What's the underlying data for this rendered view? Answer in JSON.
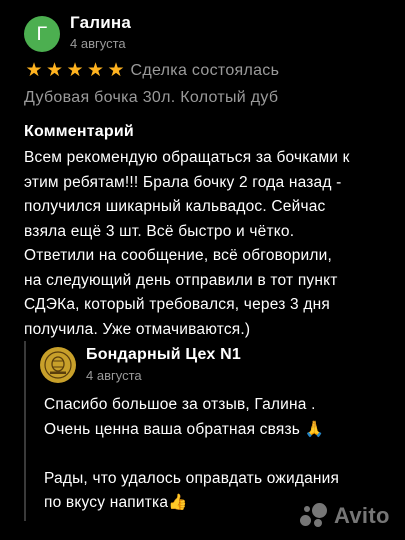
{
  "review": {
    "avatar_letter": "Г",
    "avatar_color": "#4caf50",
    "author_name": "Галина",
    "date": "4 августа",
    "rating": 5,
    "stars": [
      "★",
      "★",
      "★",
      "★",
      "★"
    ],
    "star_color": "#ffb320",
    "deal_status": "Сделка состоялась",
    "item_title": "Дубовая бочка 30л. Колотый дуб",
    "comment_heading": "Комментарий",
    "comment_text": "Всем рекомендую обращаться за бочками к\nэтим ребятам!!! Брала бочку 2 года назад -\nполучился шикарный кальвадос. Сейчас\nвзяла ещё 3 шт. Всё быстро и чётко.\nОтветили на сообщение, всё обговорили,\nна следующий день отправили в тот пункт\nСДЭКа, который требовался, через 3 дня\nполучила. Уже отмачиваются.)"
  },
  "reply": {
    "author_name": "Бондарный Цех N1",
    "date": "4 августа",
    "logo_color": "#c8a02a",
    "text": "Спасибо большое за отзыв, Галина .\nОчень ценна ваша обратная связь 🙏\n\nРады, что удалось оправдать ожидания\nпо вкусу напитка👍"
  },
  "watermark": {
    "text": "Avito",
    "icon": "avito-logo-icon"
  }
}
